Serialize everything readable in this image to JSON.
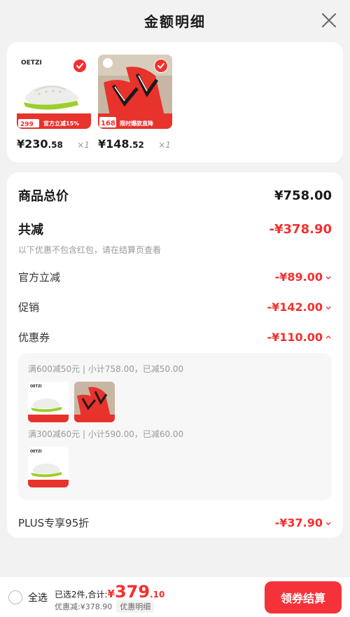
{
  "header": {
    "title": "金额明细"
  },
  "products": [
    {
      "brand": "OETZI",
      "banner_price": "299",
      "banner_text": "官方立减15%",
      "price_yen": "¥",
      "price_int": "230",
      "price_dec": ".58",
      "qty": "×1"
    },
    {
      "banner_price": "168",
      "banner_text": "限时爆款直降",
      "price_yen": "¥",
      "price_int": "148",
      "price_dec": ".52",
      "qty": "×1"
    }
  ],
  "summary": {
    "total_label": "商品总价",
    "total_value": "¥758.00",
    "reduce_label": "共减",
    "reduce_value": "-¥378.90",
    "note": "以下优惠不包含红包，请在结算页查看",
    "official_label": "官方立减",
    "official_value": "-¥89.00",
    "promo_label": "促销",
    "promo_value": "-¥142.00",
    "coupon_label": "优惠券",
    "coupon_value": "-¥110.00",
    "coupons": [
      {
        "text": "满600减50元 | 小计758.00，已减50.00"
      },
      {
        "text": "满300减60元 | 小计590.00，已减60.00"
      }
    ],
    "plus_label": "PLUS专享95折",
    "plus_value": "-¥37.90"
  },
  "bottom": {
    "select_all": "全选",
    "selected_text": "已选2件,合计:",
    "amount_yen": "¥",
    "amount_int": "379",
    "amount_dec": ".10",
    "discount_text": "优惠减:¥378.90",
    "detail_tag": "优惠明细",
    "checkout": "领券结算"
  },
  "colors": {
    "accent": "#f2302f",
    "lime": "#9bcf2a",
    "flipflop_red": "#e8322c"
  }
}
